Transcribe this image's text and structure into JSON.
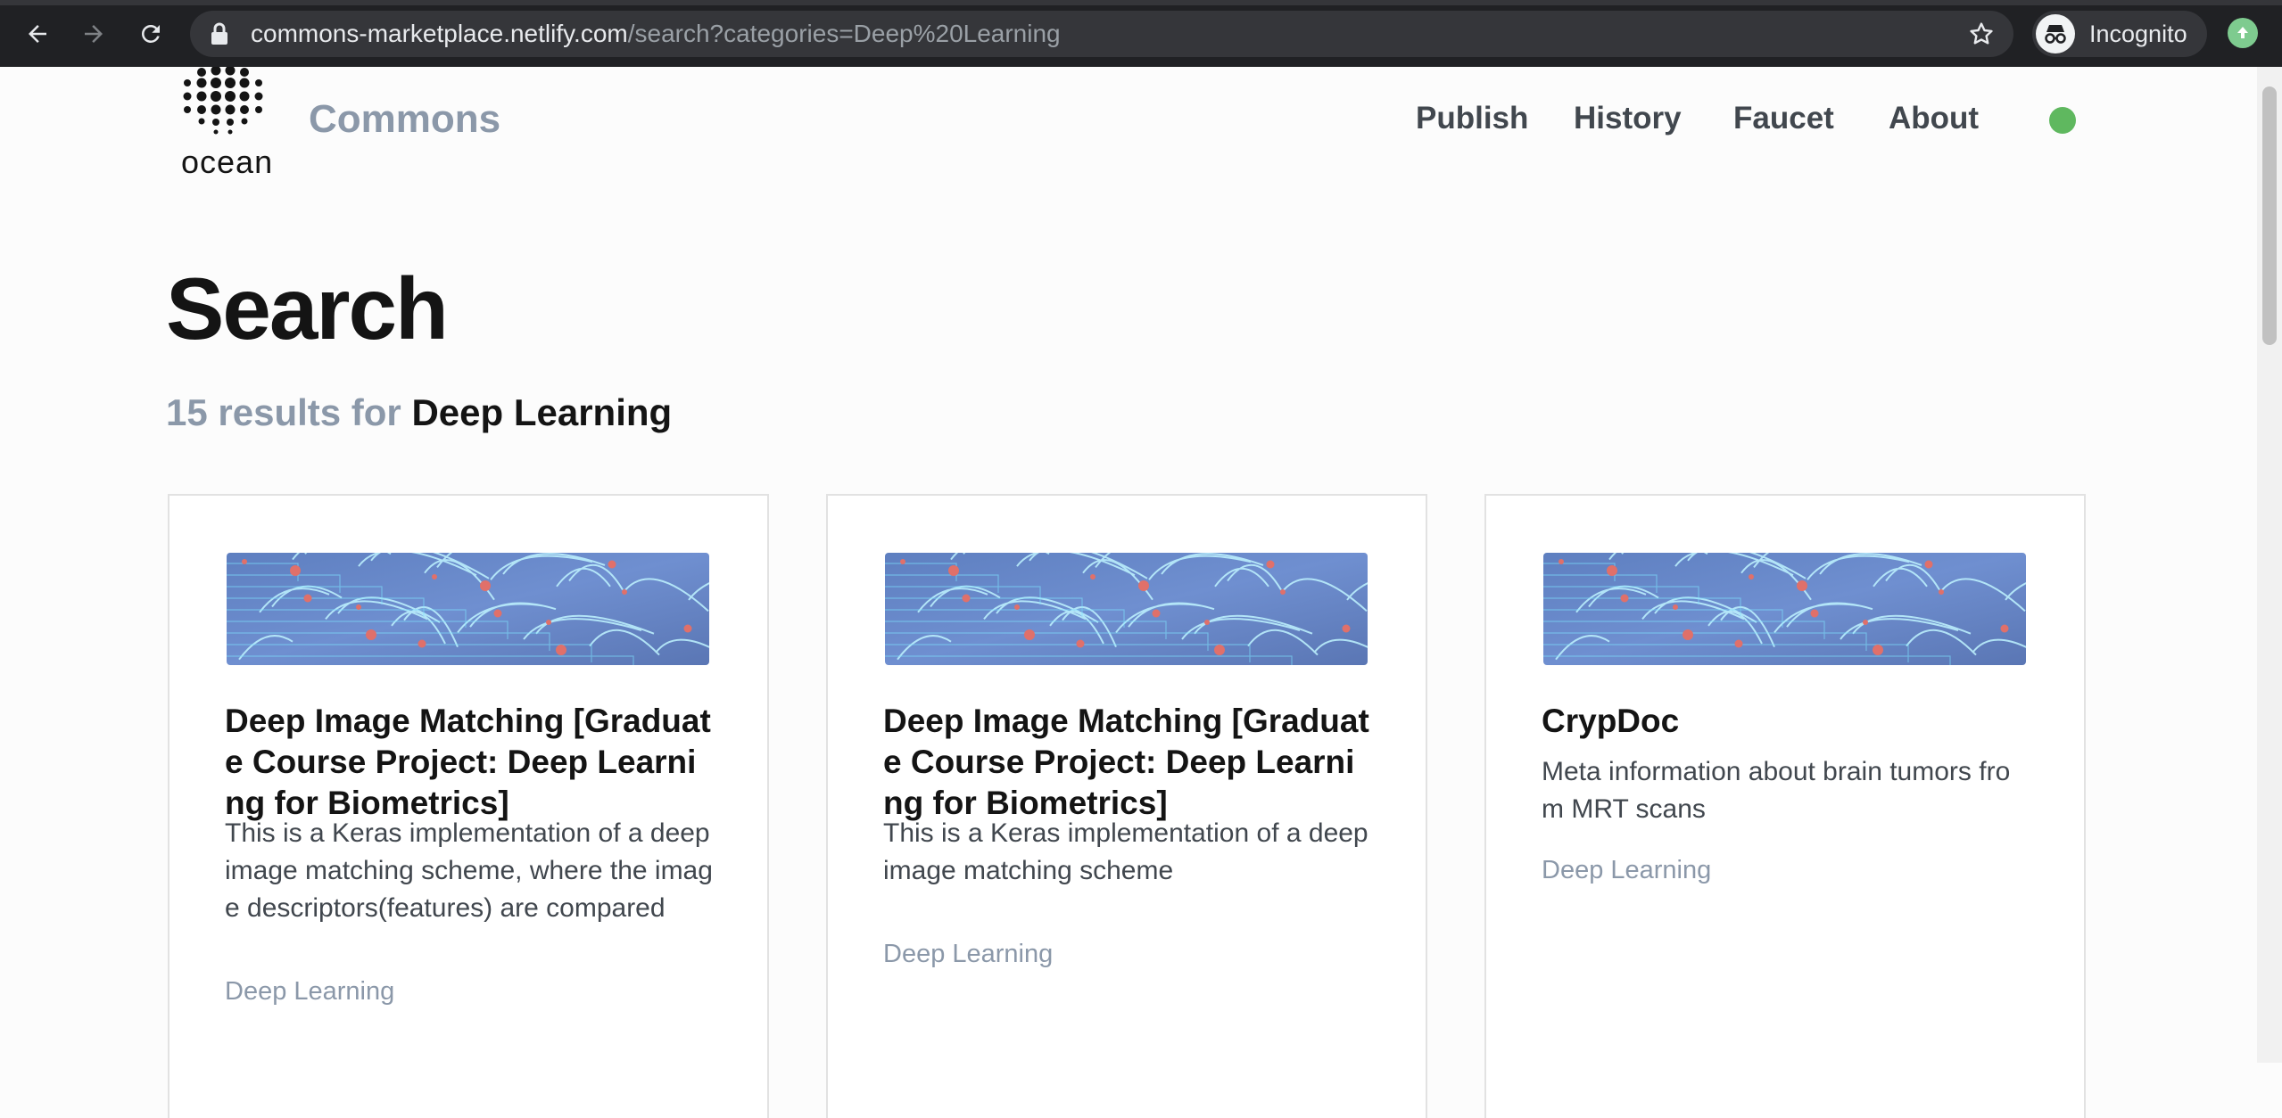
{
  "browser": {
    "url_host": "commons-marketplace.netlify.com",
    "url_path": "/search?categories=Deep%20Learning",
    "profile_label": "Incognito",
    "icons": [
      "back-icon",
      "forward-icon",
      "reload-icon",
      "lock-icon",
      "star-icon",
      "incognito-icon",
      "update-icon"
    ]
  },
  "header": {
    "logo_word": "ocean",
    "brand": "Commons",
    "nav": {
      "publish": "Publish",
      "history": "History",
      "faucet": "Faucet",
      "about": "About"
    },
    "status_color": "#5fb85f"
  },
  "search": {
    "title": "Search",
    "result_count": "15 results for",
    "query": "Deep Learning"
  },
  "results": [
    {
      "title": "Deep Image Matching [Graduate Course Project: Deep Learning for Biometrics]",
      "description": "This is a Keras implementation of a deep image matching scheme, where the image descriptors(features) are compared",
      "category": "Deep Learning"
    },
    {
      "title": "Deep Image Matching [Graduate Course Project: Deep Learning for Biometrics]",
      "description": "This is a Keras implementation of a deep image matching scheme",
      "category": "Deep Learning"
    },
    {
      "title": "CrypDoc",
      "description": "Meta information about brain tumors from MRT scans",
      "category": "Deep Learning"
    }
  ],
  "colors": {
    "accent_gray": "#8b98a9",
    "text_dark": "#141414",
    "chrome_bg": "#202124"
  }
}
